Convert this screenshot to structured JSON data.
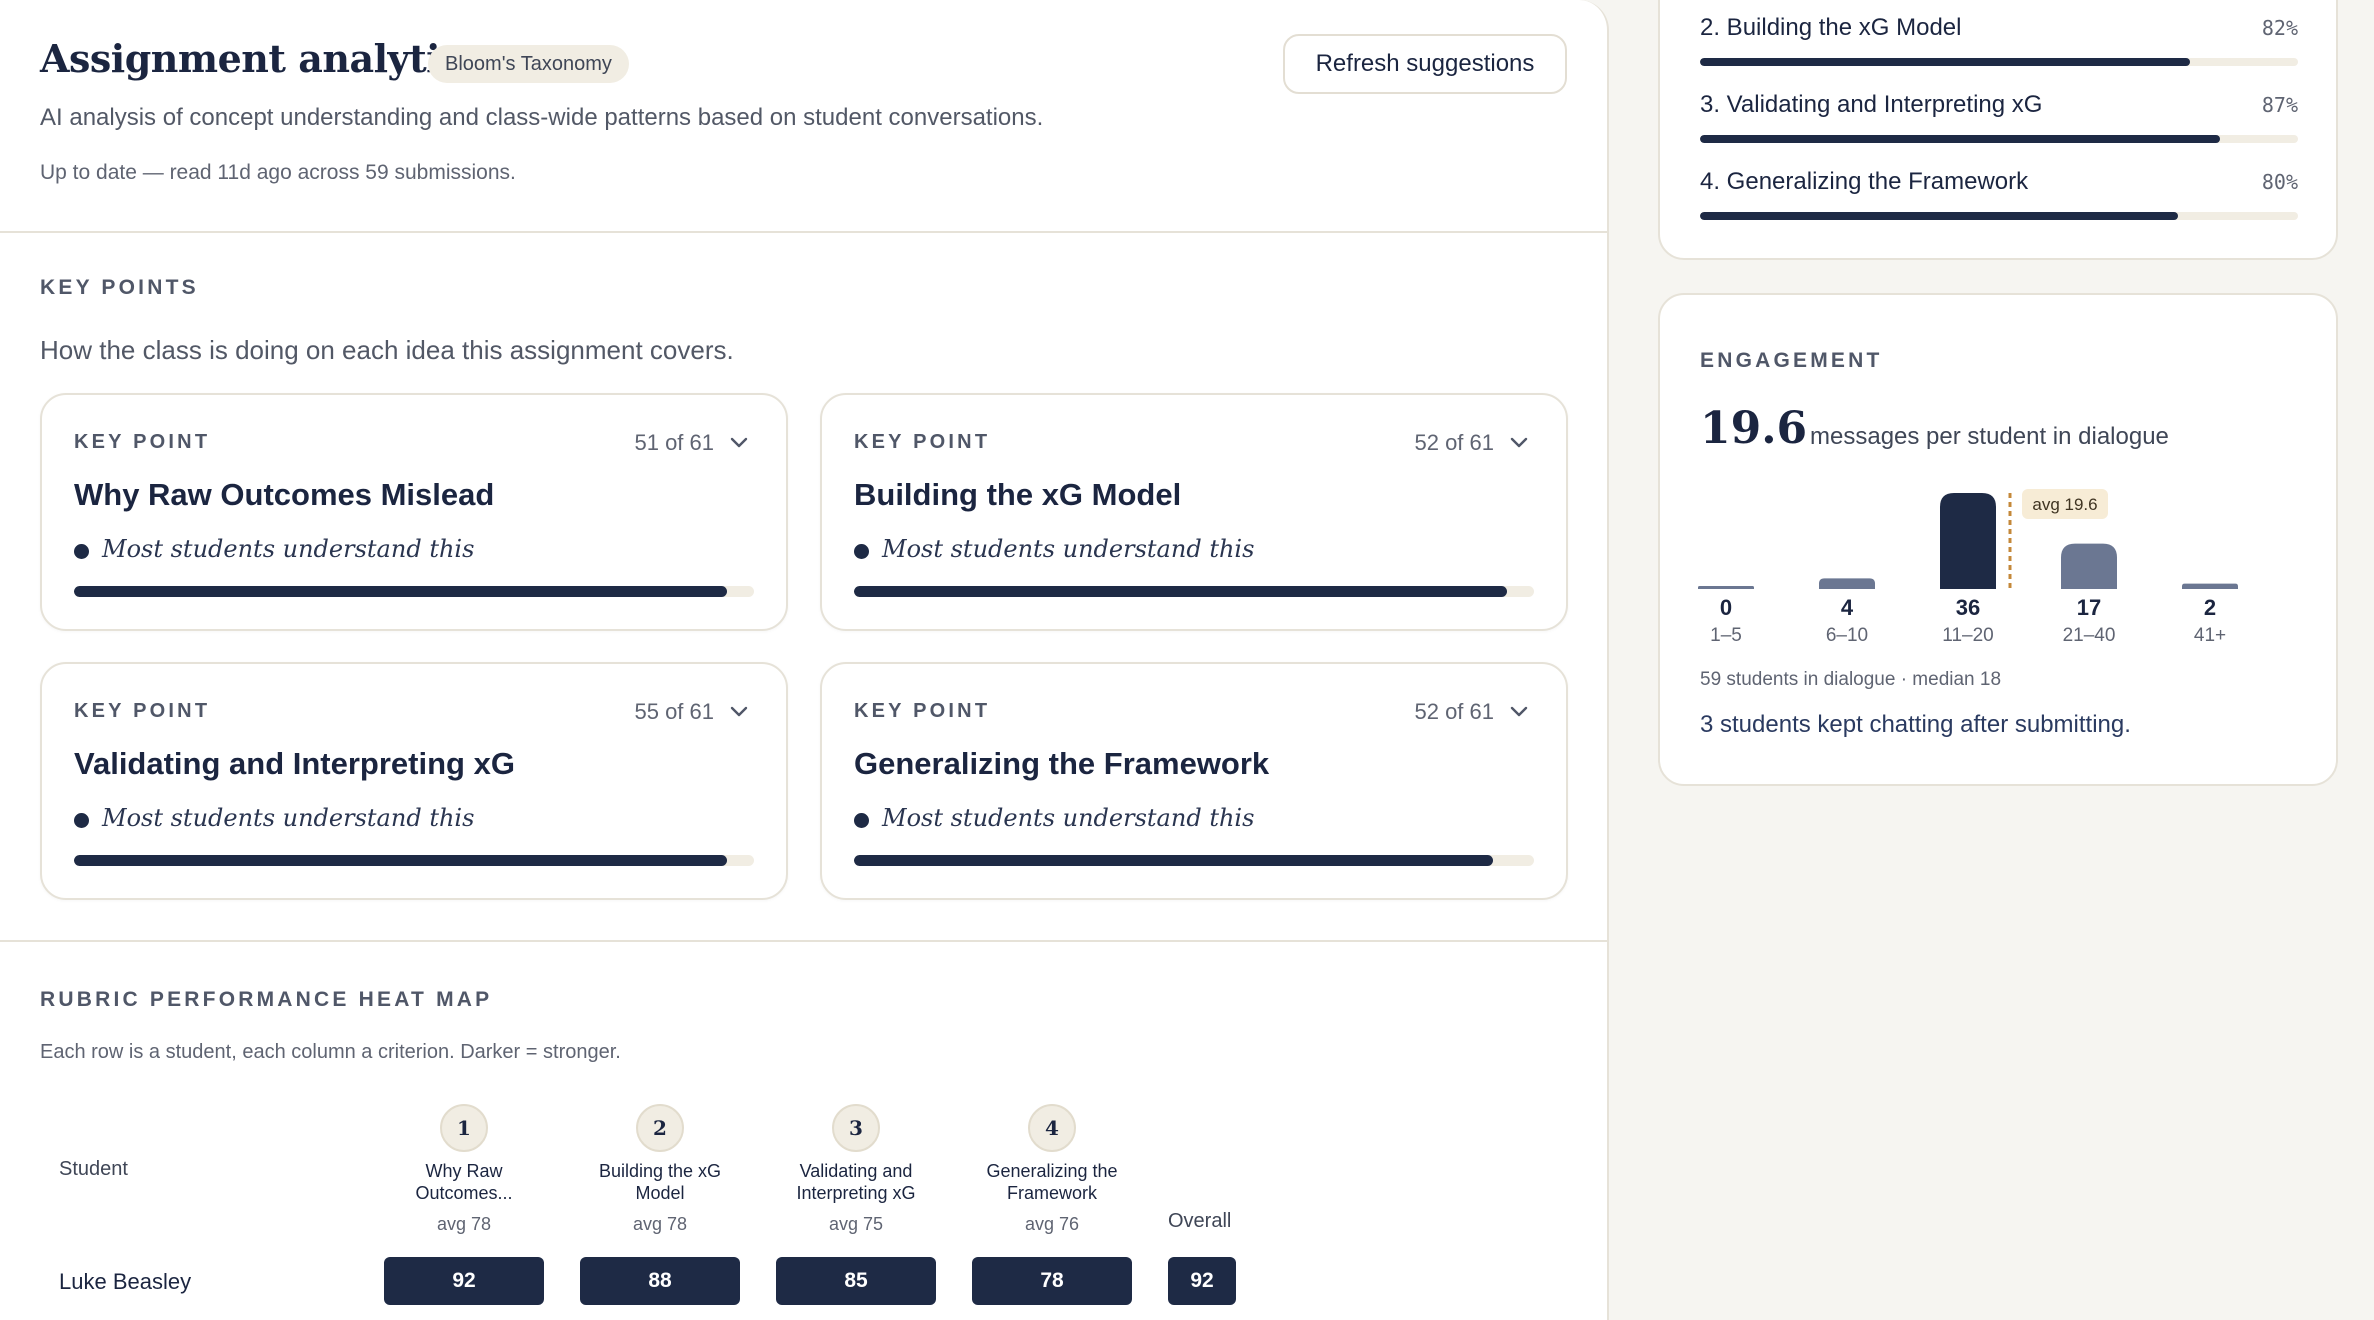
{
  "header": {
    "title": "Assignment analytics",
    "badge": "Bloom's Taxonomy",
    "refresh_label": "Refresh suggestions",
    "subtitle": "AI analysis of concept understanding and class-wide patterns based on student conversations.",
    "status": "Up to date — read 11d ago across 59 submissions."
  },
  "key_points": {
    "section_label": "KEY POINTS",
    "description": "How the class is doing on each idea this assignment covers.",
    "card_tag": "KEY POINT",
    "cards": [
      {
        "title": "Why Raw Outcomes Mislead",
        "count": "51 of 61",
        "status": "Most students understand this",
        "fraction": 0.96
      },
      {
        "title": "Building the xG Model",
        "count": "52 of 61",
        "status": "Most students understand this",
        "fraction": 0.96
      },
      {
        "title": "Validating and Interpreting xG",
        "count": "55 of 61",
        "status": "Most students understand this",
        "fraction": 0.96
      },
      {
        "title": "Generalizing the Framework",
        "count": "52 of 61",
        "status": "Most students understand this",
        "fraction": 0.94
      }
    ]
  },
  "heatmap": {
    "section_label": "RUBRIC PERFORMANCE HEAT MAP",
    "description": "Each row is a student, each column a criterion. Darker = stronger.",
    "student_header": "Student",
    "overall_header": "Overall",
    "criteria": [
      {
        "num": "1",
        "name": "Why Raw Outcomes...",
        "avg": "avg 78"
      },
      {
        "num": "2",
        "name": "Building the xG Model",
        "avg": "avg 78"
      },
      {
        "num": "3",
        "name": "Validating and Interpreting xG",
        "avg": "avg 75"
      },
      {
        "num": "4",
        "name": "Generalizing the Framework",
        "avg": "avg 76"
      }
    ],
    "rows": [
      {
        "student": "Luke Beasley",
        "scores": [
          "92",
          "88",
          "85",
          "78"
        ],
        "overall": "92"
      }
    ]
  },
  "progress": {
    "items": [
      {
        "label": "2. Building the xG Model",
        "pct_text": "82%",
        "fraction": 0.82
      },
      {
        "label": "3. Validating and Interpreting xG",
        "pct_text": "87%",
        "fraction": 0.87
      },
      {
        "label": "4. Generalizing the Framework",
        "pct_text": "80%",
        "fraction": 0.8
      }
    ]
  },
  "engagement": {
    "label": "ENGAGEMENT",
    "value": "19.6",
    "unit": "messages per student in dialogue",
    "avg_label": "avg 19.6",
    "footer_small": "59 students in dialogue · median 18",
    "footer_note": "3 students kept chatting after submitting.",
    "colors": {
      "highlight": "#1e2a45",
      "normal": "#6b7792",
      "avg_marker": "#c4883a",
      "avg_bg": "#f7ecd6"
    },
    "chart_data": {
      "type": "bar",
      "categories": [
        "1–5",
        "6–10",
        "11–20",
        "21–40",
        "41+"
      ],
      "values": [
        0,
        4,
        36,
        17,
        2
      ],
      "highlight_index": 2,
      "average": 19.6
    }
  }
}
